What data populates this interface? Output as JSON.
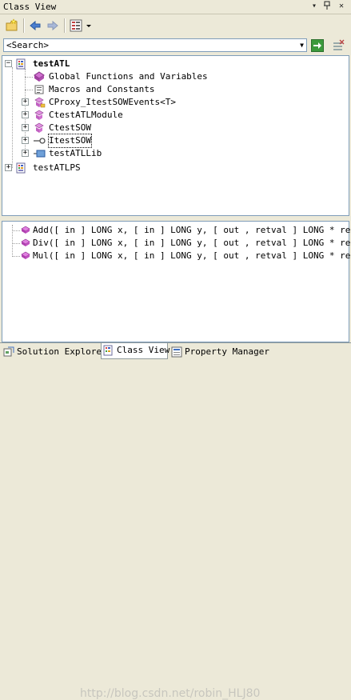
{
  "window": {
    "title": "Class View",
    "controls": {
      "dropdown": "▾",
      "pin": "ᚆ",
      "close": "✕"
    }
  },
  "search": {
    "value": "<Search>"
  },
  "tree": [
    {
      "label": "testATL",
      "bold": true,
      "icon": "project-icon",
      "expander": "−",
      "indent": 0
    },
    {
      "label": "Global Functions and Variables",
      "icon": "globals-icon",
      "expander": "",
      "indent": 1
    },
    {
      "label": "Macros and Constants",
      "icon": "macros-icon",
      "expander": "",
      "indent": 1
    },
    {
      "label": "CProxy_ItestSOWEvents<T>",
      "icon": "class-icon",
      "expander": "+",
      "indent": 1
    },
    {
      "label": "CtestATLModule",
      "icon": "class-icon",
      "expander": "+",
      "indent": 1
    },
    {
      "label": "CtestSOW",
      "icon": "class-icon",
      "expander": "+",
      "indent": 1
    },
    {
      "label": "ItestSOW",
      "icon": "interface-icon",
      "expander": "+",
      "indent": 1,
      "selected": true
    },
    {
      "label": "testATLLib",
      "icon": "library-icon",
      "expander": "+",
      "indent": 1
    },
    {
      "label": "testATLPS",
      "icon": "project-icon",
      "expander": "+",
      "indent": 0
    }
  ],
  "members": [
    {
      "label": "Add([ in ] LONG x, [ in ] LONG y, [ out , retval ] LONG * ret)",
      "icon": "method-icon"
    },
    {
      "label": "Div([ in ] LONG x, [ in ] LONG y, [ out , retval ] LONG * ret)",
      "icon": "method-icon"
    },
    {
      "label": "Mul([ in ] LONG x, [ in ] LONG y, [ out , retval ] LONG * ret)",
      "icon": "method-icon"
    }
  ],
  "tabs": [
    {
      "label": "Solution Explorer",
      "icon": "solution-explorer-icon",
      "active": false
    },
    {
      "label": "Class View",
      "icon": "class-view-icon",
      "active": true
    },
    {
      "label": "Property Manager",
      "icon": "property-manager-icon",
      "active": false
    }
  ],
  "watermark": "http://blog.csdn.net/robin_HLJ80",
  "colors": {
    "method": "#c040c0",
    "class": "#d070c0",
    "selection_text": "#000000"
  }
}
